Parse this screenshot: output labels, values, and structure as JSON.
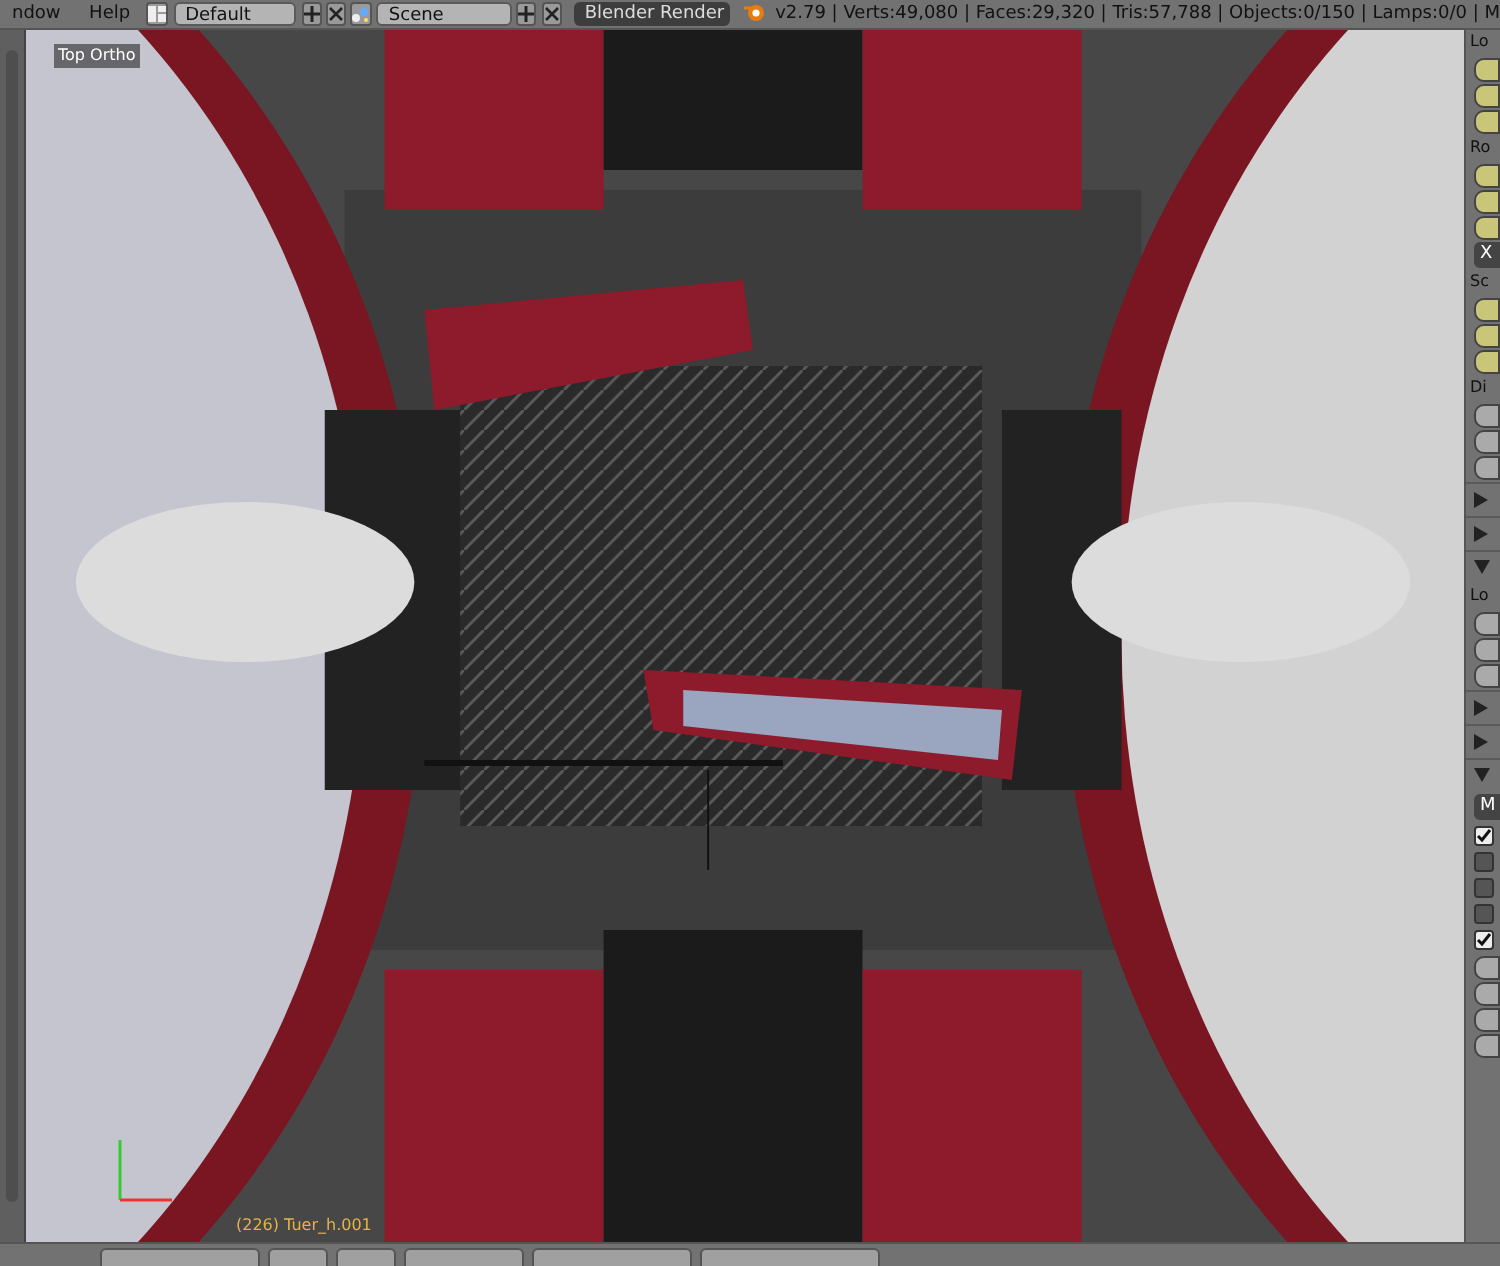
{
  "menu": [
    {
      "label": "ndow"
    },
    {
      "label": "Help"
    }
  ],
  "screen_layout": {
    "value": "Default"
  },
  "scene": {
    "value": "Scene"
  },
  "render_engine": {
    "value": "Blender Render"
  },
  "stats": "v2.79 | Verts:49,080 | Faces:29,320 | Tris:57,788 | Objects:0/150 | Lamps:0/0 | M",
  "viewport": {
    "view_label": "Top Ortho",
    "object_label": "(226) Tuer_h.001"
  },
  "properties_panel": {
    "items": [
      {
        "kind": "label",
        "text": "Lo"
      },
      {
        "kind": "field",
        "animated": true
      },
      {
        "kind": "field",
        "animated": true
      },
      {
        "kind": "field",
        "animated": true
      },
      {
        "kind": "label",
        "text": "Ro"
      },
      {
        "kind": "field",
        "animated": true
      },
      {
        "kind": "field",
        "animated": true
      },
      {
        "kind": "field",
        "animated": true
      },
      {
        "kind": "button",
        "text": "X"
      },
      {
        "kind": "label",
        "text": "Sc"
      },
      {
        "kind": "field",
        "animated": true
      },
      {
        "kind": "field",
        "animated": true
      },
      {
        "kind": "field",
        "animated": true
      },
      {
        "kind": "label",
        "text": "Di"
      },
      {
        "kind": "field",
        "animated": false
      },
      {
        "kind": "field",
        "animated": false
      },
      {
        "kind": "field",
        "animated": false
      },
      {
        "kind": "header",
        "expanded": false
      },
      {
        "kind": "header",
        "expanded": false
      },
      {
        "kind": "header",
        "expanded": true
      },
      {
        "kind": "label",
        "text": "Lo"
      },
      {
        "kind": "field",
        "animated": false
      },
      {
        "kind": "field",
        "animated": false
      },
      {
        "kind": "field",
        "animated": false
      },
      {
        "kind": "header",
        "expanded": false
      },
      {
        "kind": "header",
        "expanded": false
      },
      {
        "kind": "header",
        "expanded": true
      },
      {
        "kind": "button",
        "text": "M"
      },
      {
        "kind": "checkbox",
        "checked": true
      },
      {
        "kind": "checkbox",
        "checked": false
      },
      {
        "kind": "checkbox",
        "checked": false
      },
      {
        "kind": "checkbox",
        "checked": false
      },
      {
        "kind": "checkbox",
        "checked": true
      },
      {
        "kind": "field",
        "animated": false
      },
      {
        "kind": "field",
        "animated": false
      },
      {
        "kind": "field",
        "animated": false
      },
      {
        "kind": "field",
        "animated": false
      }
    ]
  }
}
